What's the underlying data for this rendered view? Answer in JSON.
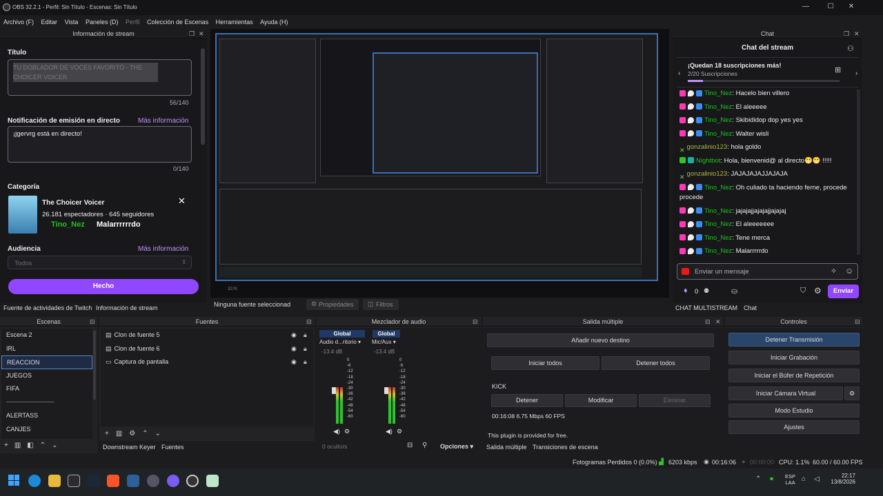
{
  "window": {
    "title": "OBS 32.2.1 - Perfil: Sin Título - Escenas: Sin Título"
  },
  "menu": [
    "Archivo (F)",
    "Editar",
    "Vista",
    "Paneles (D)",
    "Perfil",
    "Colección de Escenas",
    "Herramientas",
    "Ayuda (H)"
  ],
  "info_panel": {
    "header": "Información de stream",
    "title_label": "Título",
    "title_value": "TU DOBLADOR DE VOCES FAVORITO - THE CHOICER VOICER",
    "title_count": "56/140",
    "notif_label": "Notificación de emisión en directo",
    "notif_more": "Más información",
    "notif_value": "¡jgervrg está en directo!",
    "notif_count": "0/140",
    "category_label": "Categoría",
    "category_name": "The Choicer Voicer",
    "category_stats": "26.181 espectadores · 645 seguidores",
    "category_overlay_name": "Tino_Nez",
    "category_overlay_text": "Malarrrrrrdo",
    "audience_label": "Audiencia",
    "audience_more": "Más información",
    "audience_value": "Todos",
    "done_button": "Hecho"
  },
  "left_tabs": [
    "Fuente de actividades de Twitch",
    "Información de stream"
  ],
  "preview_zoom": "31%",
  "source_toolbar": {
    "none_selected": "Ninguna fuente seleccionad",
    "properties": "Propiedades",
    "filters": "Filtros"
  },
  "chat": {
    "header": "Chat",
    "title": "Chat del stream",
    "goal_title": "¡Quedan 18 suscripciones más!",
    "goal_sub": "2/20 Suscripciones",
    "goal_progress": 0.1,
    "messages": [
      {
        "user": "Tino_Nez",
        "text": "Hacelo bien villero",
        "type": "tino"
      },
      {
        "user": "Tino_Nez",
        "text": "El aleeeee",
        "type": "tino"
      },
      {
        "user": "Tino_Nez",
        "text": "Skibididop dop yes yes",
        "type": "tino"
      },
      {
        "user": "Tino_Nez",
        "text": "Walter wisli",
        "type": "tino"
      },
      {
        "user": "gonzalinio123",
        "text": "hola goldo",
        "type": "gonza"
      },
      {
        "user": "Nightbot",
        "text": "Hola, bienvenid@ al directo😁😁 !!!!!",
        "type": "night"
      },
      {
        "user": "gonzalinio123",
        "text": "JAJAJAJAJJAJAJA",
        "type": "gonza"
      },
      {
        "user": "Tino_Nez",
        "text": "Oh culiado ta haciendo ferne, procede procede",
        "type": "tino2"
      },
      {
        "user": "Tino_Nez",
        "text": "jajajajjajajajjajajaj",
        "type": "tino"
      },
      {
        "user": "Tino_Nez",
        "text": "El aleeeeeee",
        "type": "tino"
      },
      {
        "user": "Tino_Nez",
        "text": "Tene merca",
        "type": "tino"
      },
      {
        "user": "Tino_Nez",
        "text": "Malarrrrrdo",
        "type": "tino"
      }
    ],
    "input_placeholder": "Enviar un mensaje",
    "points": "0",
    "send": "Enviar"
  },
  "chat_tabs": [
    "CHAT MULTISTREAM",
    "Chat"
  ],
  "scenes": {
    "header": "Escenas",
    "items": [
      "Escena 2",
      "IRL",
      "REACCION",
      "JUEGOS",
      "FIFA",
      "-----------------------------------",
      "ALERTASS",
      "CANJES"
    ],
    "selected": 2
  },
  "sources": {
    "header": "Fuentes",
    "items": [
      "Clon de fuente 5",
      "Clon de fuente 6",
      "Captura de pantalla"
    ]
  },
  "scene_tabs": [
    "Downstream Keyer",
    "Fuentes"
  ],
  "mixer": {
    "header": "Mezclador de audio",
    "channels": [
      {
        "tag": "Global",
        "name": "Audio d...ritorio",
        "db": "-13.4 dB",
        "level": 0.55
      },
      {
        "tag": "Global",
        "name": "Mic/Aux",
        "db": "-13.4 dB",
        "level": 0.55
      }
    ],
    "scale": [
      "0",
      "-6",
      "-12",
      "-18",
      "-24",
      "-30",
      "-36",
      "-42",
      "-48",
      "-54",
      "-60"
    ],
    "hidden": "0 oculto/s",
    "options": "Opciones"
  },
  "multi": {
    "header": "Salida múltiple",
    "add": "Añadir nuevo destino",
    "start_all": "Iniciar todos",
    "stop_all": "Detener todos",
    "target": "KICK",
    "stop": "Detener",
    "modify": "Modificar",
    "delete": "Eliminar",
    "stats": "00:16:08  6.75 Mbps  60 FPS",
    "plugin": "This plugin is provided for free."
  },
  "multi_tabs": [
    "Salida múltiple",
    "Transiciones de escena"
  ],
  "controls": {
    "header": "Controles",
    "buttons": [
      "Detener Transmisión",
      "Iniciar Grabación",
      "Iniciar el Búfer de Repetición",
      "Iniciar Cámara Virtual",
      "Modo Estudio",
      "Ajustes"
    ]
  },
  "status": {
    "dropped": "Fotogramas Perdidos 0 (0.0%)",
    "kbps": "6203 kbps",
    "time": "00:16:06",
    "rec": "00:00:00",
    "cpu": "CPU: 1.1%",
    "fps": "60.00 / 60.00 FPS"
  },
  "taskbar": {
    "lang1": "ESP",
    "lang2": "LAA",
    "time": "22:17",
    "date": "13/8/2026"
  },
  "colors": {
    "accent": "#9147ff",
    "selection": "#3b6fb6",
    "chat_name": "#1ec41e"
  }
}
